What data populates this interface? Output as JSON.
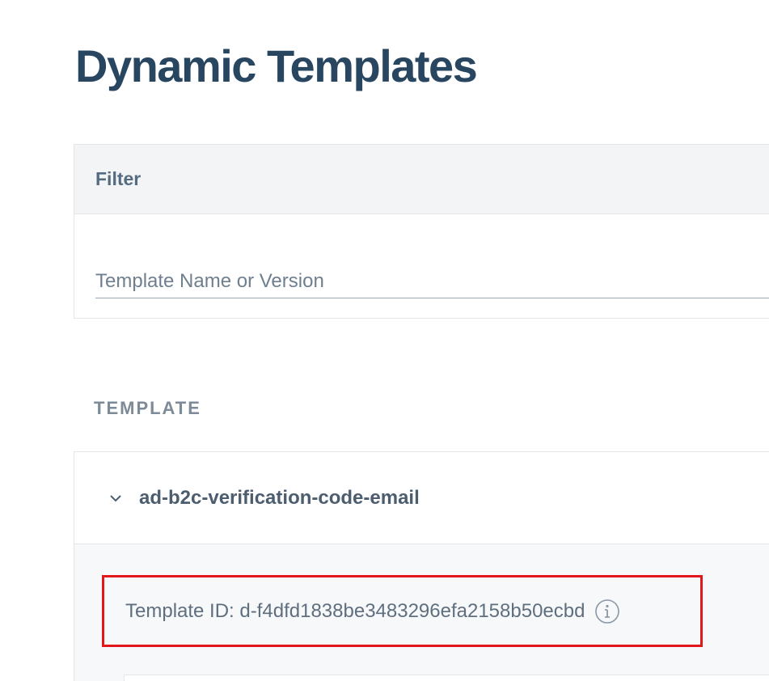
{
  "page": {
    "title": "Dynamic Templates"
  },
  "filter": {
    "header": "Filter",
    "input_placeholder": "Template Name or Version",
    "input_value": ""
  },
  "section": {
    "label": "TEMPLATE"
  },
  "template": {
    "name": "ad-b2c-verification-code-email",
    "expanded": true,
    "id_text": "Template ID: d-f4dfd1838be3483296efa2158b50ecbd",
    "info_icon": "info-circle-icon",
    "chevron_icon": "chevron-down-icon"
  },
  "colors": {
    "title": "#294661",
    "highlight_border": "#e1171c",
    "card_border": "#e4e7ea",
    "header_bg": "#f3f4f6"
  }
}
